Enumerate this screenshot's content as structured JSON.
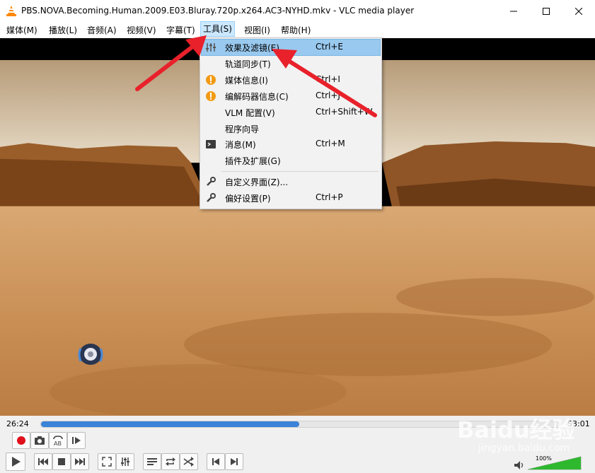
{
  "window": {
    "title": "PBS.NOVA.Becoming.Human.2009.E03.Bluray.720p.x264.AC3-NYHD.mkv - VLC media player",
    "icon": "vlc-cone-icon"
  },
  "menubar": {
    "items": [
      {
        "label": "媒体(M)"
      },
      {
        "label": "播放(L)"
      },
      {
        "label": "音频(A)"
      },
      {
        "label": "视频(V)"
      },
      {
        "label": "字幕(T)"
      },
      {
        "label": "工具(S)"
      },
      {
        "label": "视图(I)"
      },
      {
        "label": "帮助(H)"
      }
    ],
    "active": "工具(S)"
  },
  "tools_menu": {
    "items": [
      {
        "label": "效果及滤镜(E)",
        "shortcut": "Ctrl+E",
        "icon": "equalizer-icon",
        "highlighted": true
      },
      {
        "label": "轨道同步(T)",
        "shortcut": "",
        "icon": ""
      },
      {
        "label": "媒体信息(I)",
        "shortcut": "Ctrl+I",
        "icon": "info-icon"
      },
      {
        "label": "编解码器信息(C)",
        "shortcut": "Ctrl+J",
        "icon": "info-icon"
      },
      {
        "label": "VLM 配置(V)",
        "shortcut": "Ctrl+Shift+W",
        "icon": ""
      },
      {
        "label": "程序向导",
        "shortcut": "",
        "icon": ""
      },
      {
        "label": "消息(M)",
        "shortcut": "Ctrl+M",
        "icon": "terminal-icon"
      },
      {
        "label": "插件及扩展(G)",
        "shortcut": "",
        "icon": ""
      },
      {
        "label": "自定义界面(Z)...",
        "shortcut": "",
        "icon": "wrench-icon"
      },
      {
        "label": "偏好设置(P)",
        "shortcut": "Ctrl+P",
        "icon": "wrench-icon"
      }
    ]
  },
  "playback": {
    "elapsed": "26:24",
    "total": "53:01",
    "progress": 0.498,
    "volume_label": "100%",
    "volume": 1.0
  },
  "watermark": {
    "brand": "Baidu经验",
    "url": "jingyan.baidu.com"
  },
  "colors": {
    "accent": "#3a83d8",
    "menu_highlight": "#99c9ef",
    "arrow": "#e8212b",
    "record": "#e0101a",
    "volume": "#2eb82e"
  }
}
